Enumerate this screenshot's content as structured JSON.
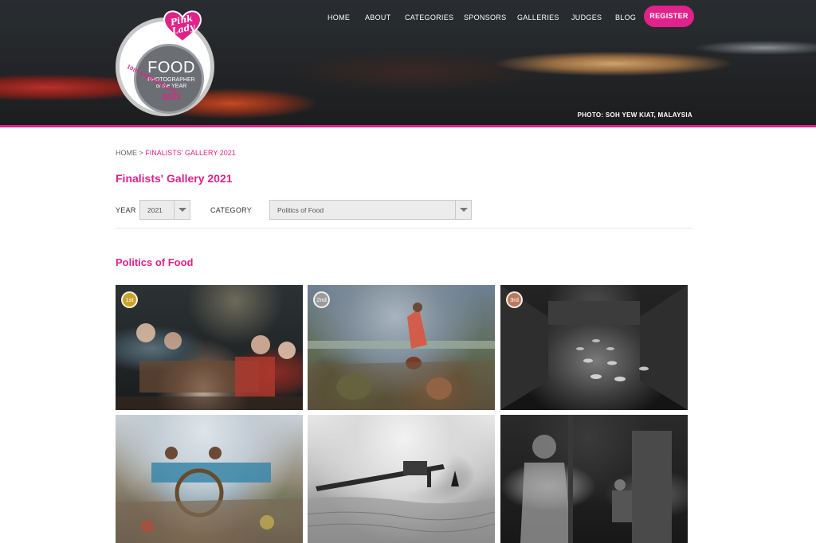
{
  "header": {
    "photo_credit": "PHOTO: SOH YEW KIAT, MALAYSIA",
    "accent_color": "#e0228a"
  },
  "logo": {
    "brand": "Pink Lady",
    "title": "FOOD",
    "subtitle_line1": "PHOTOGRAPHER",
    "subtitle_line2": "of the YEAR",
    "year": "2021",
    "anniversary": "10th ANNIVERSARY"
  },
  "nav": {
    "items": [
      {
        "label": "HOME"
      },
      {
        "label": "ABOUT"
      },
      {
        "label": "CATEGORIES"
      },
      {
        "label": "SPONSORS"
      },
      {
        "label": "GALLERIES"
      },
      {
        "label": "JUDGES"
      },
      {
        "label": "BLOG"
      }
    ],
    "register_label": "REGISTER"
  },
  "breadcrumb": {
    "home": "HOME",
    "separator": " > ",
    "current": "FINALISTS' GALLERY 2021"
  },
  "page_title": "Finalists' Gallery 2021",
  "filters": {
    "year_label": "YEAR",
    "year_value": "2021",
    "category_label": "CATEGORY",
    "category_value": "Politics of Food"
  },
  "section_title": "Politics of Food",
  "gallery": {
    "badges": [
      {
        "label": "1st",
        "color": "#c9a227"
      },
      {
        "label": "2nd",
        "color": "#9a9a9a"
      },
      {
        "label": "3rd",
        "color": "#b87a5e"
      }
    ]
  }
}
